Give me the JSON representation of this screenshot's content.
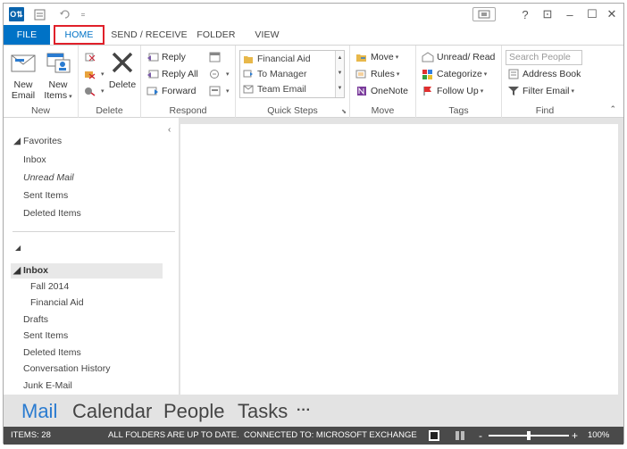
{
  "titlebar": {
    "app_logo": "O⇅",
    "icons": [
      "send-receive-icon",
      "undo-icon",
      "customize-qat-icon"
    ],
    "window_buttons": [
      "?",
      "⊡",
      "–",
      "☐",
      "✕"
    ]
  },
  "tabs": [
    {
      "label": "FILE"
    },
    {
      "label": "HOME"
    },
    {
      "label": "SEND / RECEIVE"
    },
    {
      "label": "FOLDER"
    },
    {
      "label": "VIEW"
    }
  ],
  "ribbon": {
    "new_group": {
      "label": "New",
      "new_email": "New\nEmail",
      "new_email_line1": "New",
      "new_email_line2": "Email",
      "new_items_line1": "New",
      "new_items_line2": "Items"
    },
    "delete_group": {
      "label": "Delete",
      "delete": "Delete"
    },
    "respond_group": {
      "label": "Respond",
      "reply": "Reply",
      "reply_all": "Reply All",
      "forward": "Forward"
    },
    "quick_steps_group": {
      "label": "Quick Steps",
      "items": [
        "Financial Aid",
        "To Manager",
        "Team Email"
      ]
    },
    "move_group": {
      "label": "Move",
      "move": "Move",
      "rules": "Rules",
      "onenote": "OneNote"
    },
    "tags_group": {
      "label": "Tags",
      "unread_read": "Unread/ Read",
      "categorize": "Categorize",
      "follow_up": "Follow Up"
    },
    "find_group": {
      "label": "Find",
      "search_placeholder": "Search People",
      "address_book": "Address Book",
      "filter_email": "Filter Email"
    }
  },
  "folder_pane": {
    "favorites_header": "◢ Favorites",
    "favorites": [
      "Inbox",
      "Unread Mail",
      "Sent Items",
      "Deleted Items"
    ],
    "account_header": "◢",
    "inbox_header": "◢ Inbox",
    "inbox_children": [
      "Fall 2014",
      "Financial Aid"
    ],
    "folders": [
      "Drafts",
      "Sent Items",
      "Deleted Items",
      "Conversation History",
      "Junk E-Mail"
    ]
  },
  "navbar": {
    "items": [
      "Mail",
      "Calendar",
      "People",
      "Tasks",
      "···"
    ]
  },
  "statusbar": {
    "items_count": "ITEMS: 28",
    "sync_status": "ALL FOLDERS ARE UP TO DATE.",
    "connection": "CONNECTED TO: MICROSOFT EXCHANGE",
    "zoom": "100%"
  },
  "colors": {
    "accent": "#0072c6",
    "active_tab_outline": "#e0202a",
    "nav_active": "#2a7bd0",
    "statusbar": "#4a4a4a"
  }
}
